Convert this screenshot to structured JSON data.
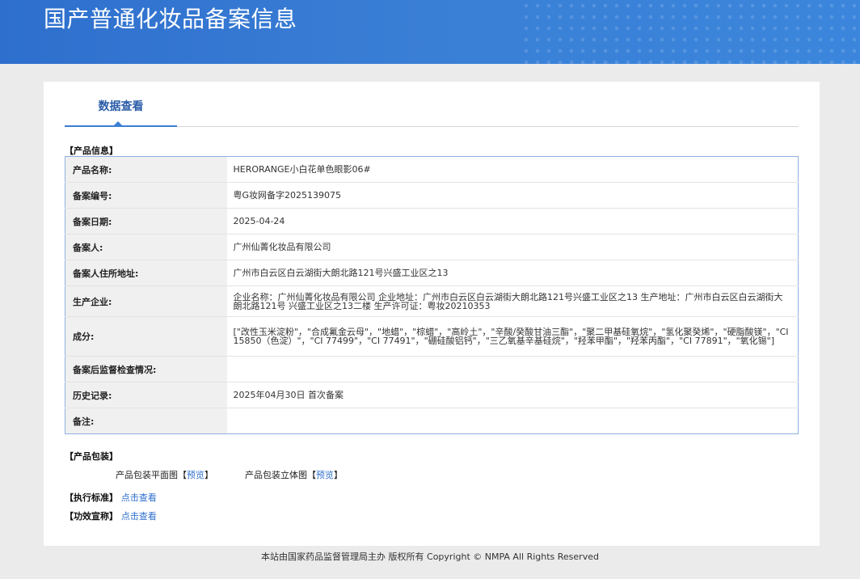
{
  "header": {
    "title": "国产普通化妆品备案信息"
  },
  "tabs": [
    {
      "label": "数据查看"
    }
  ],
  "product_info": {
    "section_label": "【产品信息】",
    "rows": [
      {
        "label": "产品名称:",
        "value": "HERORANGE小白花单色眼影06#"
      },
      {
        "label": "备案编号:",
        "value": "粤G妆网备字2025139075"
      },
      {
        "label": "备案日期:",
        "value": "2025-04-24"
      },
      {
        "label": "备案人:",
        "value": "广州仙菁化妆品有限公司"
      },
      {
        "label": "备案人住所地址:",
        "value": "广州市白云区白云湖街大朗北路121号兴盛工业区之13"
      },
      {
        "label": "生产企业:",
        "value": "企业名称：广州仙菁化妆品有限公司 企业地址：广州市白云区白云湖街大朗北路121号兴盛工业区之13 生产地址：广州市白云区白云湖街大朗北路121号 兴盛工业区之13二楼 生产许可证：粤妆20210353"
      },
      {
        "label": "成分:",
        "value": "[\"改性玉米淀粉\"，\"合成氟金云母\"，\"地蜡\"，\"棕蜡\"，\"高岭土\"，\"辛酸/癸酸甘油三酯\"，\"聚二甲基硅氧烷\"，\"氢化聚癸烯\"，\"硬脂酸镁\"，\"CI 15850（色淀）\"，\"CI 77499\"，\"CI 77491\"，\"硼硅酸铝钙\"，\"三乙氧基辛基硅烷\"，\"羟苯甲酯\"，\"羟苯丙酯\"，\"CI 77891\"，\"氧化锡\"]"
      },
      {
        "label": "备案后监督检查情况:",
        "value": ""
      },
      {
        "label": "历史记录:",
        "value": "2025年04月30日 首次备案"
      },
      {
        "label": "备注:",
        "value": ""
      }
    ]
  },
  "packaging": {
    "section_label": "【产品包装】",
    "flat_label": "产品包装平面图",
    "flat_link": "预览",
    "three_d_label": "产品包装立体图",
    "three_d_link": "预览"
  },
  "standards": {
    "label": "【执行标准】",
    "link": "点击查看"
  },
  "efficacy": {
    "label": "【功效宣称】",
    "link": "点击查看"
  },
  "footer": {
    "text": "本站由国家药品监督管理局主办 版权所有 Copyright © NMPA All Rights Reserved"
  }
}
